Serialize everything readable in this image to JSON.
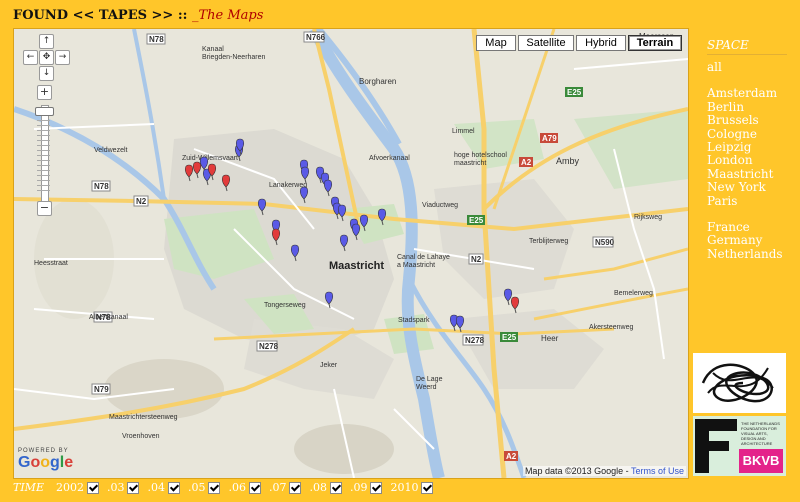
{
  "header": {
    "title": "FOUND << TAPES >> :: ",
    "subtitle": "_The Maps"
  },
  "map": {
    "types": [
      "Map",
      "Satellite",
      "Hybrid",
      "Terrain"
    ],
    "active_type": "Terrain",
    "powered_by": "POWERED BY",
    "google": [
      "G",
      "o",
      "o",
      "g",
      "l",
      "e"
    ],
    "attribution": "Map data ©2013 Google - ",
    "terms": "Terms of Use",
    "labels": {
      "meerssen": "Meerssen",
      "kanaal": "Kanaal\nBriegden-Neerharen",
      "borgharen": "Borgharen",
      "afvoerkanaal": "Afvoerkanaal",
      "limmel": "Limmel",
      "hoge_school": "hoge hotelschool\nmaastricht",
      "amby": "Amby",
      "zuid": "Zuid-Willemsvaart",
      "veldwezelt": "Veldwezelt",
      "viaductweg": "Viaductweg",
      "maastricht": "Maastricht",
      "canal": "Canal de Lahaye\na Maastricht",
      "heeswater": "Heesstraat",
      "albertkanaal": "Albertkanaal",
      "tongerseweg": "Tongerseweg",
      "stadspark": "Stadspark",
      "heer": "Heer",
      "akersteenweg": "Akersteenweg",
      "jeker": "Jeker",
      "de_lage_weerd": "De Lage\nWeerd",
      "vroenhoven": "Vroenhoven",
      "maastrichtersteenweg": "Maastrichtersteenweg",
      "terblijterweg": "Terblijterweg",
      "bemelerweg": "Bemelerweg",
      "rijksweg": "Rijksweg",
      "lanakerweg": "Lanakerweg",
      "n2": "N2",
      "n278": "N278",
      "n78": "N78",
      "n79": "N79",
      "n590": "N590",
      "e25": "E25",
      "a2": "A2",
      "a79": "A79",
      "n766": "N766"
    }
  },
  "sidebar": {
    "heading": "SPACE",
    "all": "all",
    "cities": [
      "Amsterdam",
      "Berlin",
      "Brussels",
      "Cologne",
      "Leipzig",
      "London",
      "Maastricht",
      "New York",
      "Paris"
    ],
    "countries": [
      "France",
      "Germany",
      "Netherlands"
    ]
  },
  "logos": {
    "fonds_text": "THE NETHERLANDS FOUNDATION FOR VISUAL ARTS, DESIGN AND ARCHITECTURE",
    "bkvb": "BKVB"
  },
  "timebar": {
    "label": "TIME",
    "years": [
      "2002",
      ".03",
      ".04",
      ".05",
      ".06",
      ".07",
      ".08",
      ".09",
      "2010"
    ]
  },
  "colors": {
    "background": "#FFC62A",
    "marker_blue": "#5A5AE6",
    "marker_red": "#E23B3B",
    "river": "#A9C7E8",
    "major_road": "#F7D06B"
  }
}
